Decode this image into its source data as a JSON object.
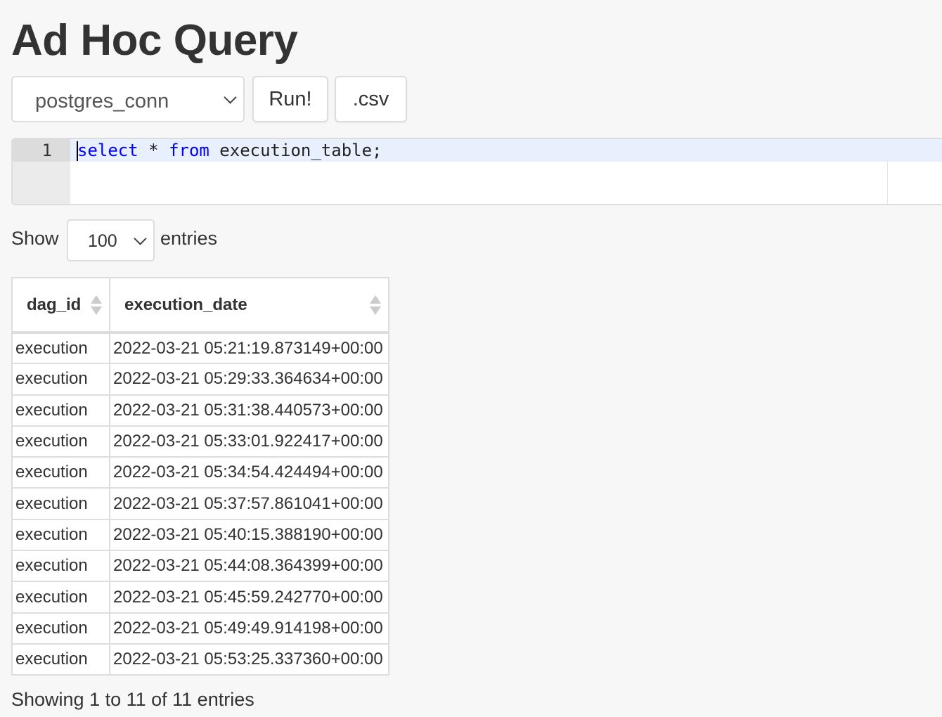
{
  "page": {
    "title": "Ad Hoc Query"
  },
  "toolbar": {
    "connection_selected": "postgres_conn",
    "run_label": "Run!",
    "csv_label": ".csv"
  },
  "editor": {
    "line_number": "1",
    "query": {
      "kw_select": "select",
      "star": " * ",
      "kw_from": "from",
      "rest": " execution_table;"
    }
  },
  "length_menu": {
    "show_label": "Show",
    "selected": "100",
    "entries_label": "entries"
  },
  "table": {
    "columns": [
      "dag_id",
      "execution_date"
    ],
    "rows": [
      [
        "execution",
        "2022-03-21 05:21:19.873149+00:00"
      ],
      [
        "execution",
        "2022-03-21 05:29:33.364634+00:00"
      ],
      [
        "execution",
        "2022-03-21 05:31:38.440573+00:00"
      ],
      [
        "execution",
        "2022-03-21 05:33:01.922417+00:00"
      ],
      [
        "execution",
        "2022-03-21 05:34:54.424494+00:00"
      ],
      [
        "execution",
        "2022-03-21 05:37:57.861041+00:00"
      ],
      [
        "execution",
        "2022-03-21 05:40:15.388190+00:00"
      ],
      [
        "execution",
        "2022-03-21 05:44:08.364399+00:00"
      ],
      [
        "execution",
        "2022-03-21 05:45:59.242770+00:00"
      ],
      [
        "execution",
        "2022-03-21 05:49:49.914198+00:00"
      ],
      [
        "execution",
        "2022-03-21 05:53:25.337360+00:00"
      ]
    ]
  },
  "info": {
    "text": "Showing 1 to 11 of 11 entries"
  },
  "colors": {
    "keyword": "#0000ff",
    "active_line": "#e8f0fe",
    "border": "#dddddd",
    "background": "#f7f7f7"
  },
  "icons": {
    "select_arrow": "chevron-down-icon",
    "sort_indicator": "sort-both-icon"
  }
}
